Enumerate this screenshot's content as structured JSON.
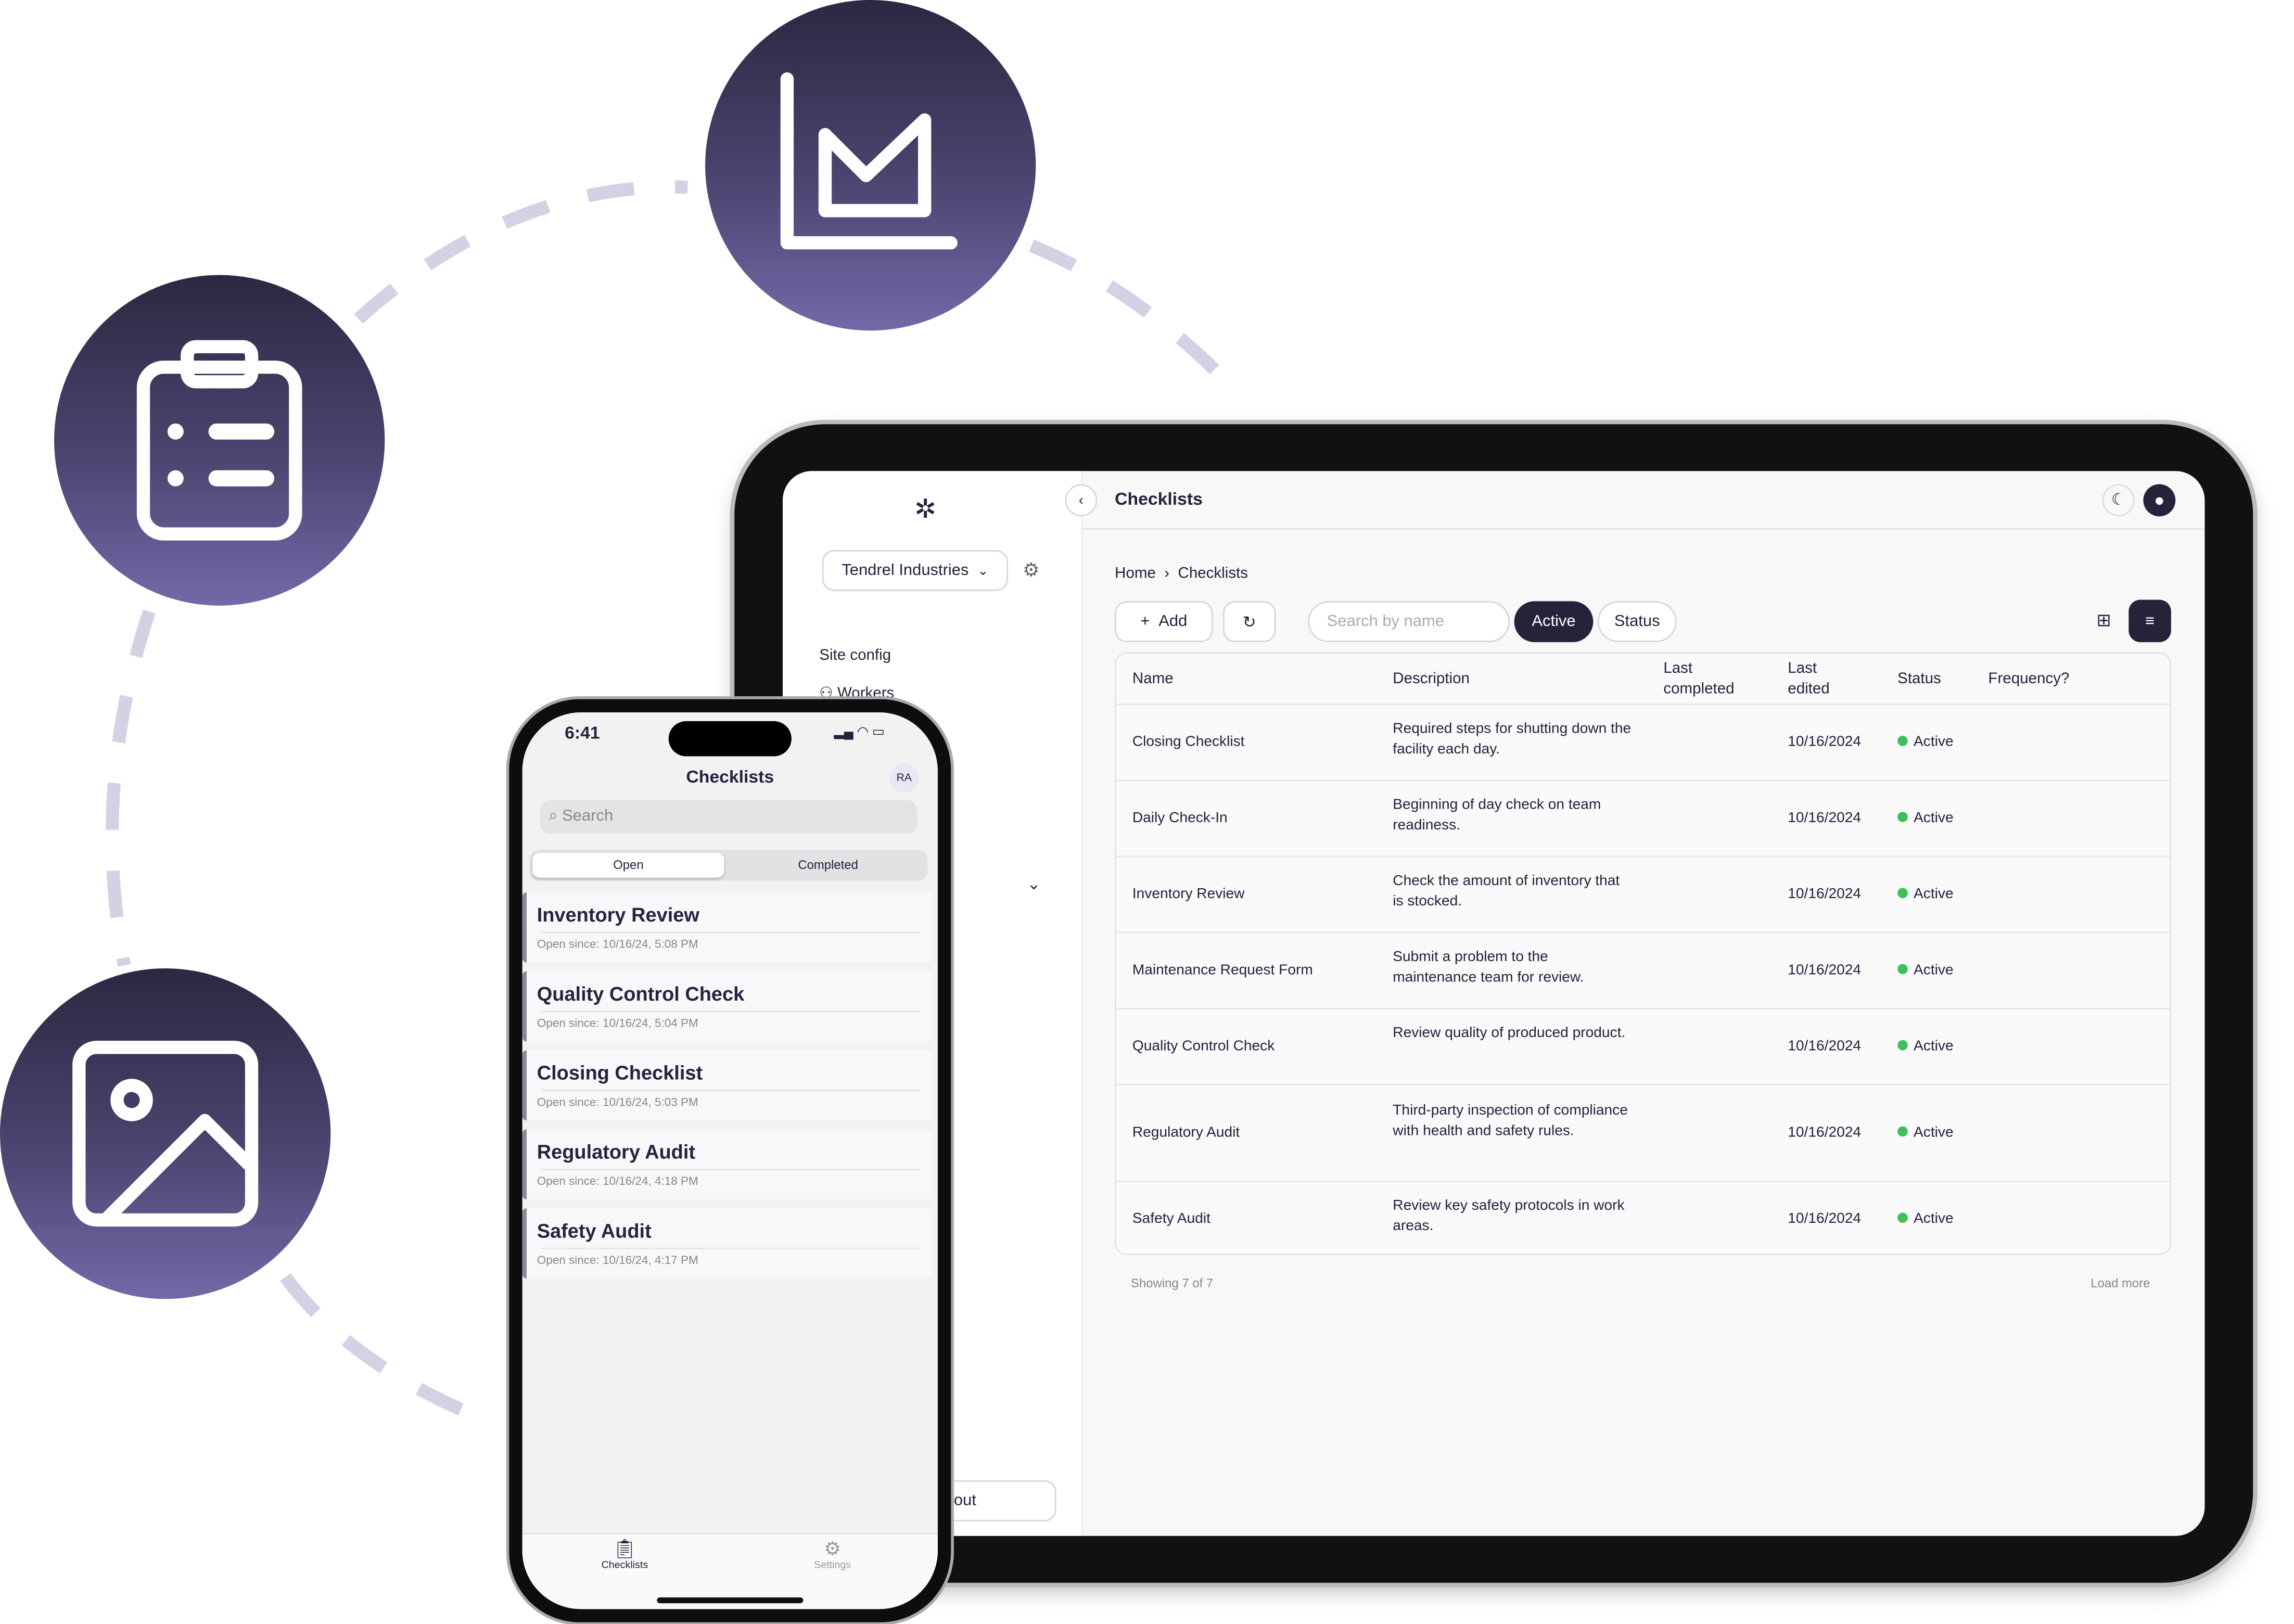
{
  "colors": {
    "circle_top": "#2b2841",
    "circle_bottom": "#7369a8",
    "dash": "#d4d1e4",
    "active_pill": "#25233a",
    "status_green": "#3fbf5a"
  },
  "decor_icons": [
    "chart-area-icon",
    "clipboard-list-icon",
    "image-icon"
  ],
  "tablet": {
    "sidebar": {
      "org": "Tendrel Industries",
      "section": "Site config",
      "items": [
        {
          "label": "Workers",
          "icon": "users-icon"
        }
      ],
      "logout": "out"
    },
    "header": {
      "title": "Checklists"
    },
    "breadcrumb": {
      "home": "Home",
      "current": "Checklists"
    },
    "toolbar": {
      "add": "Add",
      "search_placeholder": "Search by name",
      "active": "Active",
      "status": "Status"
    },
    "table": {
      "headers": {
        "name": "Name",
        "description": "Description",
        "last_completed": "Last completed",
        "last_edited": "Last edited",
        "status": "Status",
        "frequency": "Frequency?"
      },
      "rows": [
        {
          "name": "Closing Checklist",
          "description": "Required steps for shutting down the facility each day.",
          "last_completed": "",
          "last_edited": "10/16/2024",
          "status": "Active",
          "frequency": ""
        },
        {
          "name": "Daily Check-In",
          "description": "Beginning of day check on team readiness.",
          "last_completed": "",
          "last_edited": "10/16/2024",
          "status": "Active",
          "frequency": ""
        },
        {
          "name": "Inventory Review",
          "description": "Check the amount of inventory that is stocked.",
          "last_completed": "",
          "last_edited": "10/16/2024",
          "status": "Active",
          "frequency": ""
        },
        {
          "name": "Maintenance Request Form",
          "description": "Submit a problem to the maintenance team for review.",
          "last_completed": "",
          "last_edited": "10/16/2024",
          "status": "Active",
          "frequency": ""
        },
        {
          "name": "Quality Control Check",
          "description": "Review quality of produced product.",
          "last_completed": "",
          "last_edited": "10/16/2024",
          "status": "Active",
          "frequency": ""
        },
        {
          "name": "Regulatory Audit",
          "description": "Third-party inspection of compliance with health and safety rules.",
          "last_completed": "",
          "last_edited": "10/16/2024",
          "status": "Active",
          "frequency": ""
        },
        {
          "name": "Safety Audit",
          "description": "Review key safety protocols in work areas.",
          "last_completed": "",
          "last_edited": "10/16/2024",
          "status": "Active",
          "frequency": ""
        }
      ]
    },
    "footer": {
      "showing": "Showing 7 of 7",
      "load_more": "Load more"
    }
  },
  "phone": {
    "time": "6:41",
    "title": "Checklists",
    "avatar": "RA",
    "search_placeholder": "Search",
    "segments": {
      "open": "Open",
      "completed": "Completed"
    },
    "items": [
      {
        "title": "Inventory Review",
        "subtitle": "Open since: 10/16/24, 5:08 PM"
      },
      {
        "title": "Quality Control Check",
        "subtitle": "Open since: 10/16/24, 5:04 PM"
      },
      {
        "title": "Closing Checklist",
        "subtitle": "Open since: 10/16/24, 5:03 PM"
      },
      {
        "title": "Regulatory Audit",
        "subtitle": "Open since: 10/16/24, 4:18 PM"
      },
      {
        "title": "Safety Audit",
        "subtitle": "Open since: 10/16/24, 4:17 PM"
      }
    ],
    "tabs": {
      "checklists": "Checklists",
      "settings": "Settings"
    }
  }
}
